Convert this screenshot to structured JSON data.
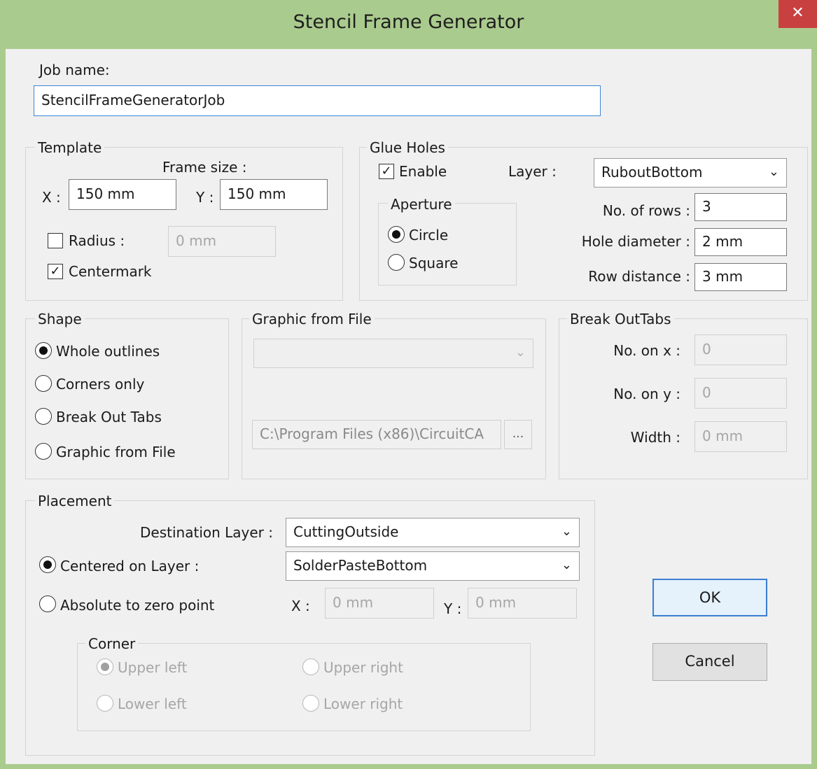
{
  "window": {
    "title": "Stencil Frame Generator",
    "close_glyph": "✕"
  },
  "job": {
    "label": "Job name:",
    "value": "StencilFrameGeneratorJob"
  },
  "template": {
    "legend": "Template",
    "frame_size_label": "Frame size :",
    "x_label": "X :",
    "x_value": "150 mm",
    "y_label": "Y :",
    "y_value": "150 mm",
    "radius_label": "Radius :",
    "radius_value": "0 mm",
    "radius_checked": false,
    "centermark_label": "Centermark",
    "centermark_checked": true
  },
  "glue_holes": {
    "legend": "Glue Holes",
    "enable_label": "Enable",
    "enable_checked": true,
    "layer_label": "Layer :",
    "layer_value": "RuboutBottom",
    "aperture_legend": "Aperture",
    "circle_label": "Circle",
    "square_label": "Square",
    "aperture_selected": "Circle",
    "rows_label": "No. of rows :",
    "rows_value": "3",
    "diameter_label": "Hole diameter :",
    "diameter_value": "2 mm",
    "row_distance_label": "Row distance :",
    "row_distance_value": "3 mm"
  },
  "shape": {
    "legend": "Shape",
    "options": [
      "Whole outlines",
      "Corners only",
      "Break Out Tabs",
      "Graphic from File"
    ],
    "selected": "Whole outlines"
  },
  "graphic_from_file": {
    "legend": "Graphic from File",
    "dropdown_value": "",
    "path_value": "C:\\Program Files (x86)\\CircuitCA",
    "browse_label": "..."
  },
  "break_out_tabs": {
    "legend": "Break OutTabs",
    "no_x_label": "No. on x :",
    "no_x_value": "0",
    "no_y_label": "No. on y :",
    "no_y_value": "0",
    "width_label": "Width :",
    "width_value": "0 mm"
  },
  "placement": {
    "legend": "Placement",
    "dest_layer_label": "Destination Layer :",
    "dest_layer_value": "CuttingOutside",
    "centered_label": "Centered on Layer :",
    "centered_value": "SolderPasteBottom",
    "absolute_label": "Absolute to zero point",
    "mode_selected": "Centered on Layer",
    "x_label": "X :",
    "x_value": "0 mm",
    "y_label": "Y :",
    "y_value": "0 mm",
    "corner": {
      "legend": "Corner",
      "upper_left": "Upper left",
      "upper_right": "Upper right",
      "lower_left": "Lower left",
      "lower_right": "Lower right",
      "selected": "Upper left"
    }
  },
  "buttons": {
    "ok": "OK",
    "cancel": "Cancel"
  },
  "colors": {
    "title_bar": "#aacb8e",
    "close_button": "#c94040",
    "focus_border": "#3a86d8"
  },
  "icons": {
    "dropdown": "chevron-down-icon",
    "close": "close-icon"
  }
}
